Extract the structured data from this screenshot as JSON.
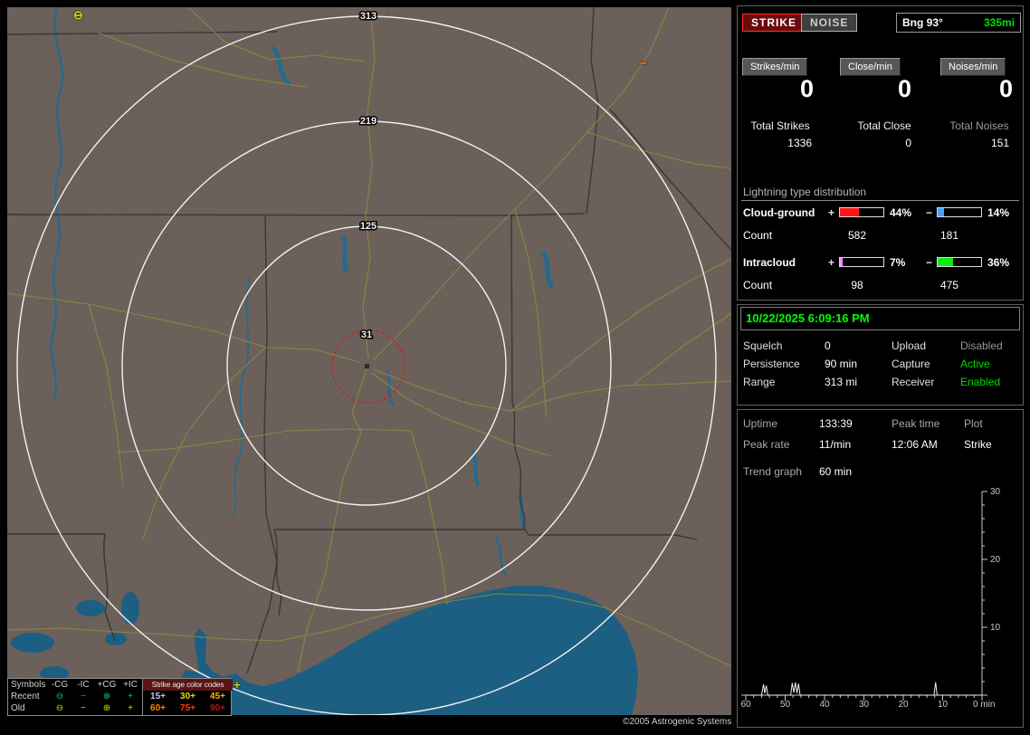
{
  "map": {
    "ring_labels": [
      "313",
      "219",
      "125",
      "31"
    ],
    "strikes": [
      {
        "glyph": "⊖",
        "style": "color:#d6d600"
      },
      {
        "glyph": "−",
        "style": "color:#ff8400"
      },
      {
        "glyph": "+",
        "style": "color:#d6d600"
      }
    ],
    "copyright": "©2005 Astrogenic Systems",
    "colors": {
      "land": "#6c605b",
      "water": "#1c5f82",
      "road": "#8e8e3a",
      "ring": "#f2f2f2",
      "alarm_ring": "#cc2222"
    }
  },
  "legend": {
    "symbols_header": "Symbols",
    "columns": [
      "-CG",
      "-IC",
      "+CG",
      "+IC"
    ],
    "age_header": "Strike age color codes",
    "rows": [
      {
        "label": "Recent",
        "glyphs": [
          "⊖",
          "−",
          "⊕",
          "+"
        ],
        "glyph_style": "color:#00cc7a",
        "ages": [
          {
            "t": "15+",
            "style": "color:#b8c8ff"
          },
          {
            "t": "30+",
            "style": "color:#e0e000"
          },
          {
            "t": "45+",
            "style": "color:#ffb400"
          }
        ]
      },
      {
        "label": "Old",
        "glyphs": [
          "⊖",
          "−",
          "⊕",
          "+"
        ],
        "glyph_style": "color:#d6d600",
        "ages": [
          {
            "t": "60+",
            "style": "color:#ff8400"
          },
          {
            "t": "75+",
            "style": "color:#ff3c00"
          },
          {
            "t": "90+",
            "style": "color:#c01010"
          }
        ]
      }
    ]
  },
  "sidebar": {
    "strike_btn": "STRIKE",
    "noise_btn": "NOISE",
    "bearing": "Bng 93°",
    "range": "335mi",
    "counters": [
      {
        "label": "Strikes/min",
        "value": "0",
        "total_label": "Total Strikes",
        "total": "1336"
      },
      {
        "label": "Close/min",
        "value": "0",
        "total_label": "Total Close",
        "total": "0"
      },
      {
        "label": "Noises/min",
        "value": "0",
        "total_label": "Total Noises",
        "total": "151"
      }
    ],
    "distribution": {
      "title": "Lightning type distribution",
      "rows": [
        {
          "label": "Cloud-ground",
          "pos_sign": "+",
          "pos_pct": "44%",
          "pos_style": "width:44%;background:#ff1414",
          "neg_sign": "−",
          "neg_pct": "14%",
          "neg_style": "width:14%;background:#4aa0ff",
          "count_label": "Count",
          "pos_count": "582",
          "neg_count": "181"
        },
        {
          "label": "Intracloud",
          "pos_sign": "+",
          "pos_pct": "7%",
          "pos_style": "width:7%;background:#ff8cff",
          "neg_sign": "−",
          "neg_pct": "36%",
          "neg_style": "width:36%;background:#12e812",
          "count_label": "Count",
          "pos_count": "98",
          "neg_count": "475"
        }
      ]
    },
    "status": {
      "datetime": "10/22/2025 6:09:16 PM",
      "rows": [
        {
          "l1": "Squelch",
          "v1": "0",
          "l2": "Upload",
          "v2": "Disabled",
          "v2_style": "color:#969696"
        },
        {
          "l1": "Persistence",
          "v1": "90 min",
          "l2": "Capture",
          "v2": "Active",
          "v2_style": "color:#00dc00"
        },
        {
          "l1": "Range",
          "v1": "313 mi",
          "l2": "Receiver",
          "v2": "Enabled",
          "v2_style": "color:#00dc00"
        }
      ]
    },
    "stats": {
      "uptime_label": "Uptime",
      "uptime": "133:39",
      "peak_time_label": "Peak time",
      "plot_label": "Plot",
      "peak_rate_label": "Peak rate",
      "peak_rate": "11/min",
      "peak_time": "12:06 AM",
      "plot_value": "Strike",
      "trend_label": "Trend graph",
      "trend_value": "60 min"
    }
  },
  "trend_graph": {
    "type": "line",
    "title": "Trend graph 60 min",
    "x_ticks": [
      "60",
      "50",
      "40",
      "30",
      "20",
      "10",
      "0 min"
    ],
    "y_ticks": [
      "30",
      "20",
      "10"
    ],
    "x_range_min_ago": [
      60,
      0
    ],
    "y_range": [
      0,
      30
    ],
    "points": [
      [
        60,
        0
      ],
      [
        56,
        0
      ],
      [
        55.5,
        1.6
      ],
      [
        55.2,
        0.3
      ],
      [
        54.8,
        1.4
      ],
      [
        54.4,
        0
      ],
      [
        48.6,
        0
      ],
      [
        48.2,
        1.8
      ],
      [
        47.8,
        0.4
      ],
      [
        47.4,
        1.9
      ],
      [
        47,
        0.3
      ],
      [
        46.6,
        1.7
      ],
      [
        46.2,
        0
      ],
      [
        12.2,
        0
      ],
      [
        11.8,
        1.9
      ],
      [
        11.4,
        0
      ],
      [
        0,
        0
      ]
    ]
  }
}
